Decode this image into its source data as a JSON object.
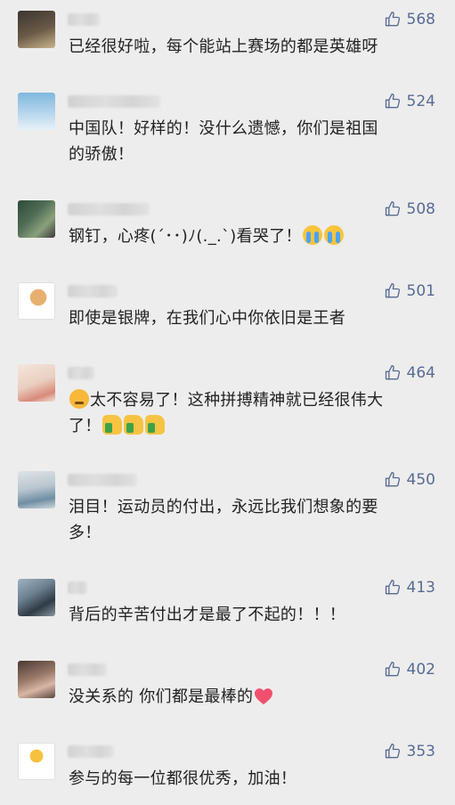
{
  "comments": [
    {
      "likes": "568",
      "text": "已经很好啦，每个能站上赛场的都是英雄呀"
    },
    {
      "likes": "524",
      "text_line1": "中国队！好样的！没什么遗憾，你们是祖国",
      "text_line2": "的骄傲！"
    },
    {
      "likes": "508",
      "text": "钢钉，心疼(´･･)ﾉ(._.`)看哭了！",
      "emojis": [
        "loudly-crying-emoji",
        "loudly-crying-emoji"
      ]
    },
    {
      "likes": "501",
      "text": "即使是银牌，在我们心中你依旧是王者"
    },
    {
      "likes": "464",
      "text_line1": "太不容易了！这种拼搏精神就已经很伟大",
      "text_line2": "了！",
      "emojis": [
        "angry-face-emoji",
        "thumbs-up-emoji",
        "thumbs-up-emoji",
        "thumbs-up-emoji"
      ]
    },
    {
      "likes": "450",
      "text_line1": "泪目！运动员的付出，永远比我们想象的要",
      "text_line2": "多！"
    },
    {
      "likes": "413",
      "text": "背后的辛苦付出才是最了不起的！！！"
    },
    {
      "likes": "402",
      "text": "没关系的 你们都是最棒的",
      "emojis": [
        "heart-emoji"
      ]
    },
    {
      "likes": "353",
      "text": "参与的每一位都很优秀，加油！"
    }
  ],
  "colors": {
    "background": "#ededed",
    "like_count": "#576b95",
    "text": "#222222",
    "heart": "#f0506e"
  }
}
